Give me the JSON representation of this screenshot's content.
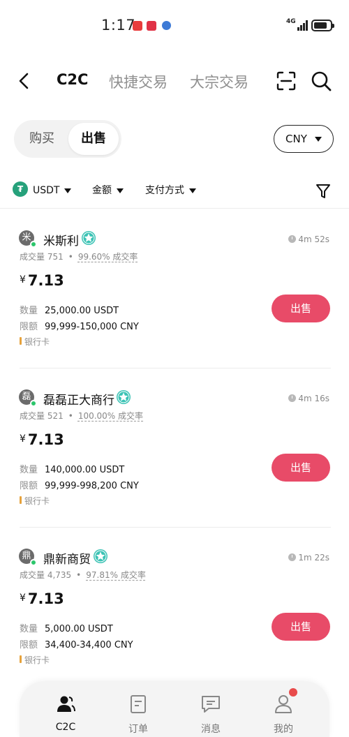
{
  "status_bar": {
    "time": "1:17",
    "network": "4G"
  },
  "nav": {
    "tabs": [
      {
        "label": "C2C",
        "active": true
      },
      {
        "label": "快捷交易",
        "active": false
      },
      {
        "label": "大宗交易",
        "active": false
      }
    ]
  },
  "trade_toggle": {
    "buy": "购买",
    "sell": "出售",
    "selected": "出售"
  },
  "currency": {
    "selected": "CNY"
  },
  "filters": {
    "coin": "USDT",
    "amount": "金额",
    "payment": "支付方式"
  },
  "labels": {
    "quantity": "数量",
    "limit": "限额",
    "yen": "¥"
  },
  "listings": [
    {
      "avatar": "米",
      "name": "米斯利",
      "volume": "成交量 751",
      "rate": "99.60% 成交率",
      "time": "4m 52s",
      "price": "7.13",
      "quantity": "25,000.00 USDT",
      "limit": "99,999-150,000 CNY",
      "payment": "银行卡",
      "action": "出售"
    },
    {
      "avatar": "磊",
      "name": "磊磊正大商行",
      "volume": "成交量 521",
      "rate": "100.00% 成交率",
      "time": "4m 16s",
      "price": "7.13",
      "quantity": "140,000.00 USDT",
      "limit": "99,999-998,200 CNY",
      "payment": "银行卡",
      "action": "出售"
    },
    {
      "avatar": "鼎",
      "name": "鼎新商贸",
      "volume": "成交量 4,735",
      "rate": "97.81% 成交率",
      "time": "1m 22s",
      "price": "7.13",
      "quantity": "5,000.00 USDT",
      "limit": "34,400-34,400 CNY",
      "payment": "银行卡",
      "action": "出售"
    }
  ],
  "bottom_nav": [
    {
      "label": "C2C",
      "icon": "users-icon",
      "active": true
    },
    {
      "label": "订单",
      "icon": "order-icon",
      "active": false
    },
    {
      "label": "消息",
      "icon": "message-icon",
      "active": false
    },
    {
      "label": "我的",
      "icon": "profile-icon",
      "active": false,
      "badge": true
    }
  ],
  "colors": {
    "accent": "#e84b68",
    "online": "#2cc66c",
    "verified": "#3cc3b5",
    "usdt": "#26a17b"
  }
}
